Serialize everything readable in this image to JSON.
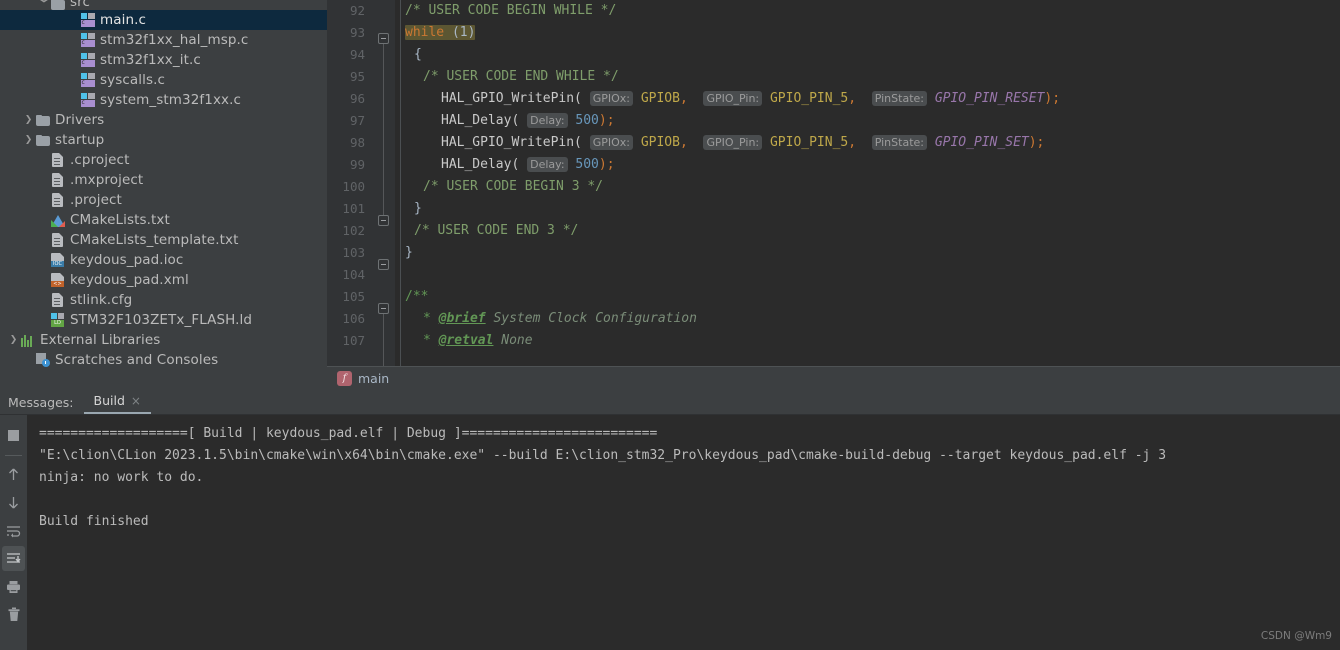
{
  "sidebar": {
    "items": [
      {
        "label": "src",
        "icon": "folder-icon",
        "indent": 2,
        "arrow": "down",
        "type": "folder",
        "clipped": true
      },
      {
        "label": "main.c",
        "icon": "c-file-icon",
        "indent": 4,
        "arrow": "",
        "type": "c-file",
        "selected": true
      },
      {
        "label": "stm32f1xx_hal_msp.c",
        "icon": "c-file-icon",
        "indent": 4,
        "arrow": "",
        "type": "c-file"
      },
      {
        "label": "stm32f1xx_it.c",
        "icon": "c-file-icon",
        "indent": 4,
        "arrow": "",
        "type": "c-file"
      },
      {
        "label": "syscalls.c",
        "icon": "c-file-icon",
        "indent": 4,
        "arrow": "",
        "type": "c-file"
      },
      {
        "label": "system_stm32f1xx.c",
        "icon": "c-file-icon",
        "indent": 4,
        "arrow": "",
        "type": "c-file"
      },
      {
        "label": "Drivers",
        "icon": "folder-icon",
        "indent": 1,
        "arrow": "right",
        "type": "folder"
      },
      {
        "label": "startup",
        "icon": "folder-icon",
        "indent": 1,
        "arrow": "right",
        "type": "folder"
      },
      {
        "label": ".cproject",
        "icon": "document-icon",
        "indent": 2,
        "arrow": "",
        "type": "doc"
      },
      {
        "label": ".mxproject",
        "icon": "document-icon",
        "indent": 2,
        "arrow": "",
        "type": "doc"
      },
      {
        "label": ".project",
        "icon": "document-icon",
        "indent": 2,
        "arrow": "",
        "type": "doc"
      },
      {
        "label": "CMakeLists.txt",
        "icon": "cmake-icon",
        "indent": 2,
        "arrow": "",
        "type": "cmake"
      },
      {
        "label": "CMakeLists_template.txt",
        "icon": "document-icon",
        "indent": 2,
        "arrow": "",
        "type": "doc"
      },
      {
        "label": "keydous_pad.ioc",
        "icon": "ioc-file-icon",
        "indent": 2,
        "arrow": "",
        "type": "ioc"
      },
      {
        "label": "keydous_pad.xml",
        "icon": "xml-file-icon",
        "indent": 2,
        "arrow": "",
        "type": "xml"
      },
      {
        "label": "stlink.cfg",
        "icon": "document-icon",
        "indent": 2,
        "arrow": "",
        "type": "doc"
      },
      {
        "label": "STM32F103ZETx_FLASH.ld",
        "icon": "linker-script-icon",
        "indent": 2,
        "arrow": "",
        "type": "ld"
      },
      {
        "label": "External Libraries",
        "icon": "libraries-icon",
        "indent": 0,
        "arrow": "right",
        "type": "libs"
      },
      {
        "label": "Scratches and Consoles",
        "icon": "scratches-icon",
        "indent": 1,
        "arrow": "",
        "type": "scratches"
      }
    ]
  },
  "editor": {
    "first_line": 92,
    "lines": [
      92,
      93,
      94,
      95,
      96,
      97,
      98,
      99,
      100,
      101,
      102,
      103,
      104,
      105,
      106,
      107
    ],
    "code": {
      "l92": "/* USER CODE BEGIN WHILE */",
      "l93_kw": "while",
      "l93_cond": " (1)",
      "l94": "{",
      "l95": "/* USER CODE END WHILE */",
      "l96_fn": "HAL_GPIO_WritePin(",
      "l96_hint1": "GPIOx:",
      "l96_arg1": "GPIOB",
      "l96_hint2": "GPIO_Pin:",
      "l96_arg2": "GPIO_PIN_5",
      "l96_hint3": "PinState:",
      "l96_arg3": "GPIO_PIN_RESET",
      "l96_tail": ");",
      "l97_fn": "HAL_Delay(",
      "l97_hint": "Delay:",
      "l97_arg": "500",
      "l97_tail": ");",
      "l98_fn": "HAL_GPIO_WritePin(",
      "l98_hint1": "GPIOx:",
      "l98_arg1": "GPIOB",
      "l98_hint2": "GPIO_Pin:",
      "l98_arg2": "GPIO_PIN_5",
      "l98_hint3": "PinState:",
      "l98_arg3": "GPIO_PIN_SET",
      "l98_tail": ");",
      "l99_fn": "HAL_Delay(",
      "l99_hint": "Delay:",
      "l99_arg": "500",
      "l99_tail": ");",
      "l100": "/* USER CODE BEGIN 3 */",
      "l101": "}",
      "l102": "/* USER CODE END 3 */",
      "l103": "}",
      "l104": "",
      "l105": "/**",
      "l106_star": "*",
      "l106_tag": "@brief",
      "l106_text": "System Clock Configuration",
      "l107_star": "*",
      "l107_tag": "@retval",
      "l107_text": "None"
    }
  },
  "breadcrumb": {
    "badge": "f",
    "label": "main"
  },
  "console": {
    "messages_label": "Messages:",
    "tab_label": "Build",
    "tab_close": "×",
    "tools": [
      {
        "name": "stop-button",
        "glyph": "stop"
      },
      {
        "name": "scroll-up-button",
        "glyph": "↑"
      },
      {
        "name": "scroll-down-button",
        "glyph": "↓"
      },
      {
        "name": "soft-wrap-button",
        "glyph": "wrap"
      },
      {
        "name": "scroll-to-end-button",
        "glyph": "end",
        "active": true
      },
      {
        "name": "print-button",
        "glyph": "print"
      },
      {
        "name": "clear-all-button",
        "glyph": "trash"
      }
    ],
    "output": [
      "===================[ Build | keydous_pad.elf | Debug ]=========================",
      "\"E:\\clion\\CLion 2023.1.5\\bin\\cmake\\win\\x64\\bin\\cmake.exe\" --build E:\\clion_stm32_Pro\\keydous_pad\\cmake-build-debug --target keydous_pad.elf -j 3",
      "ninja: no work to do.",
      "",
      "Build finished"
    ]
  },
  "watermark": "CSDN @Wm9",
  "colors": {
    "panel_bg": "#3c3f41",
    "editor_bg": "#2b2b2b",
    "gutter_bg": "#313335",
    "selection": "#0d293e",
    "keyword": "#cc7832",
    "comment": "#629755",
    "number": "#6897bb",
    "constant": "#bfa84a",
    "macro": "#9876aa",
    "text": "#a9b7c6"
  }
}
